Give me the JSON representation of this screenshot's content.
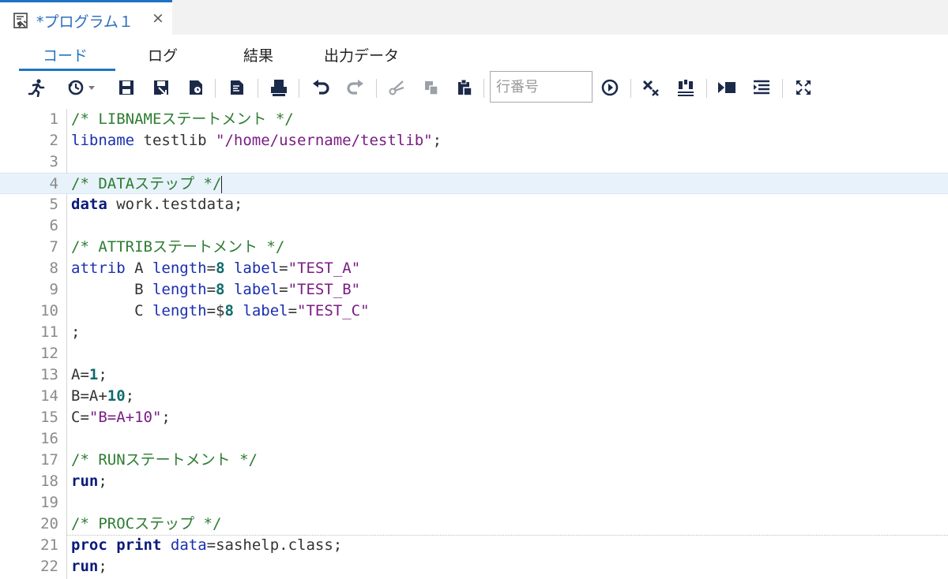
{
  "document_tab": {
    "title": "*プログラム１",
    "close_symbol": "×"
  },
  "sub_tabs": [
    "コード",
    "ログ",
    "結果",
    "出力データ"
  ],
  "toolbar": {
    "line_number_placeholder": "行番号"
  },
  "colors": {
    "accent": "#1f73c4",
    "comment": "#2e7d32",
    "keyword": "#1a2fb0",
    "string": "#7a1d84",
    "number": "#0f6b6b"
  },
  "editor": {
    "current_line": 4,
    "lines": [
      {
        "n": "1",
        "tokens": [
          {
            "t": "cmt",
            "v": "/* LIBNAMEステートメント */"
          }
        ]
      },
      {
        "n": "2",
        "tokens": [
          {
            "t": "kw",
            "v": "libname"
          },
          {
            "t": "plain",
            "v": " testlib "
          },
          {
            "t": "str",
            "v": "\"/home/username/testlib\""
          },
          {
            "t": "plain",
            "v": ";"
          }
        ]
      },
      {
        "n": "3",
        "tokens": []
      },
      {
        "n": "4",
        "tokens": [
          {
            "t": "cmt",
            "v": "/* DATAステップ */"
          }
        ]
      },
      {
        "n": "5",
        "tokens": [
          {
            "t": "kwb",
            "v": "data"
          },
          {
            "t": "plain",
            "v": " work.testdata;"
          }
        ]
      },
      {
        "n": "6",
        "tokens": []
      },
      {
        "n": "7",
        "tokens": [
          {
            "t": "cmt",
            "v": "/* ATTRIBステートメント */"
          }
        ]
      },
      {
        "n": "8",
        "tokens": [
          {
            "t": "kw",
            "v": "attrib"
          },
          {
            "t": "plain",
            "v": " A "
          },
          {
            "t": "kw",
            "v": "length"
          },
          {
            "t": "plain",
            "v": "="
          },
          {
            "t": "num",
            "v": "8"
          },
          {
            "t": "plain",
            "v": " "
          },
          {
            "t": "kw",
            "v": "label"
          },
          {
            "t": "plain",
            "v": "="
          },
          {
            "t": "str",
            "v": "\"TEST_A\""
          }
        ]
      },
      {
        "n": "9",
        "tokens": [
          {
            "t": "plain",
            "v": "       B "
          },
          {
            "t": "kw",
            "v": "length"
          },
          {
            "t": "plain",
            "v": "="
          },
          {
            "t": "num",
            "v": "8"
          },
          {
            "t": "plain",
            "v": " "
          },
          {
            "t": "kw",
            "v": "label"
          },
          {
            "t": "plain",
            "v": "="
          },
          {
            "t": "str",
            "v": "\"TEST_B\""
          }
        ]
      },
      {
        "n": "10",
        "tokens": [
          {
            "t": "plain",
            "v": "       C "
          },
          {
            "t": "kw",
            "v": "length"
          },
          {
            "t": "plain",
            "v": "=$"
          },
          {
            "t": "num",
            "v": "8"
          },
          {
            "t": "plain",
            "v": " "
          },
          {
            "t": "kw",
            "v": "label"
          },
          {
            "t": "plain",
            "v": "="
          },
          {
            "t": "str",
            "v": "\"TEST_C\""
          }
        ]
      },
      {
        "n": "11",
        "tokens": [
          {
            "t": "plain",
            "v": ";"
          }
        ]
      },
      {
        "n": "12",
        "tokens": []
      },
      {
        "n": "13",
        "tokens": [
          {
            "t": "plain",
            "v": "A="
          },
          {
            "t": "num",
            "v": "1"
          },
          {
            "t": "plain",
            "v": ";"
          }
        ]
      },
      {
        "n": "14",
        "tokens": [
          {
            "t": "plain",
            "v": "B=A+"
          },
          {
            "t": "num",
            "v": "10"
          },
          {
            "t": "plain",
            "v": ";"
          }
        ]
      },
      {
        "n": "15",
        "tokens": [
          {
            "t": "plain",
            "v": "C="
          },
          {
            "t": "str",
            "v": "\"B=A+10\""
          },
          {
            "t": "plain",
            "v": ";"
          }
        ]
      },
      {
        "n": "16",
        "tokens": []
      },
      {
        "n": "17",
        "tokens": [
          {
            "t": "cmt",
            "v": "/* RUNステートメント */"
          }
        ]
      },
      {
        "n": "18",
        "tokens": [
          {
            "t": "kwb",
            "v": "run"
          },
          {
            "t": "plain",
            "v": ";"
          }
        ]
      },
      {
        "n": "19",
        "tokens": []
      },
      {
        "n": "20",
        "tokens": [
          {
            "t": "cmt",
            "v": "/* PROCステップ */"
          }
        ]
      },
      {
        "n": "21",
        "tokens": [
          {
            "t": "kwb",
            "v": "proc"
          },
          {
            "t": "plain",
            "v": " "
          },
          {
            "t": "kwb",
            "v": "print"
          },
          {
            "t": "plain",
            "v": " "
          },
          {
            "t": "kw",
            "v": "data"
          },
          {
            "t": "plain",
            "v": "=sashelp.class;"
          }
        ]
      },
      {
        "n": "22",
        "tokens": [
          {
            "t": "kwb",
            "v": "run"
          },
          {
            "t": "plain",
            "v": ";"
          }
        ]
      }
    ]
  }
}
